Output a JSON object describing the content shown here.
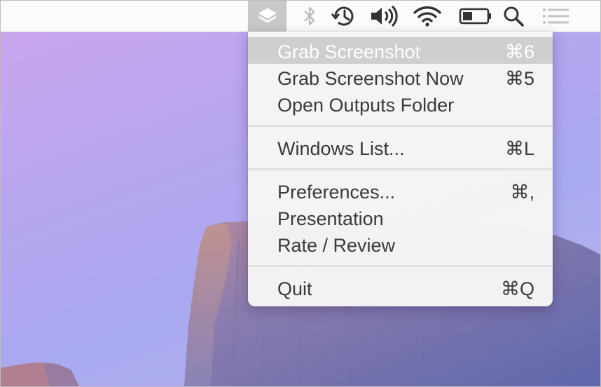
{
  "menubar": {
    "app_icon": "layers-icon",
    "status_icons": [
      "bluetooth-icon",
      "time-machine-icon",
      "volume-icon",
      "wifi-icon",
      "battery-icon",
      "spotlight-search-icon",
      "notification-center-icon"
    ]
  },
  "menu": {
    "items": [
      {
        "label": "Grab Screenshot",
        "shortcut": "⌘6",
        "highlighted": true
      },
      {
        "label": "Grab Screenshot Now",
        "shortcut": "⌘5"
      },
      {
        "label": "Open Outputs Folder",
        "shortcut": ""
      },
      {
        "label": "Windows List...",
        "shortcut": "⌘L"
      },
      {
        "label": "Preferences...",
        "shortcut": "⌘,"
      },
      {
        "label": "Presentation",
        "shortcut": ""
      },
      {
        "label": "Rate / Review",
        "shortcut": ""
      },
      {
        "label": "Quit",
        "shortcut": "⌘Q"
      }
    ]
  },
  "colors": {
    "highlight": "#cfcfcf",
    "menu_text": "#3a3a3a",
    "wallpaper_sky": "#b0a8f0",
    "rock": "#6d6fae"
  }
}
